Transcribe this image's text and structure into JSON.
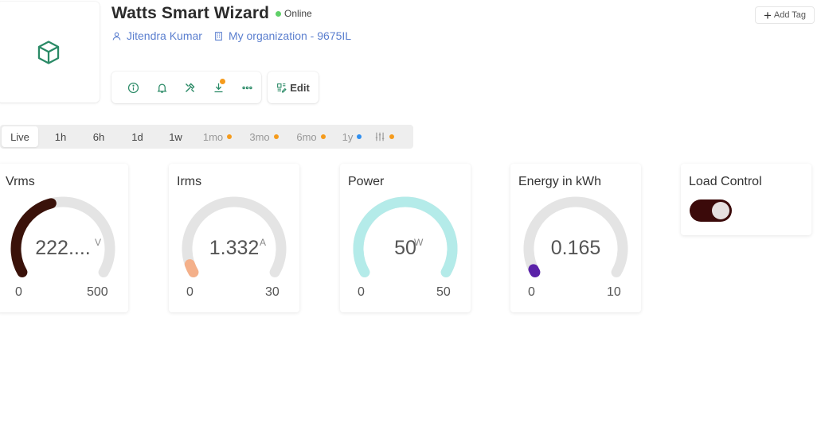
{
  "device": {
    "title": "Watts Smart Wizard",
    "status": "Online",
    "status_color": "#5fd068",
    "owner": "Jitendra Kumar",
    "organization": "My organization - 9675IL",
    "thumbnail_icon": "cube-icon"
  },
  "header": {
    "add_tag_label": "Add Tag",
    "edit_label": "Edit",
    "actions": [
      "info-icon",
      "bell-icon",
      "tools-icon",
      "download-icon",
      "more-icon"
    ]
  },
  "timebar": {
    "items": [
      {
        "label": "Live"
      },
      {
        "label": "1h"
      },
      {
        "label": "6h"
      },
      {
        "label": "1d"
      },
      {
        "label": "1w"
      },
      {
        "label": "1mo",
        "dot": "#f59b1c"
      },
      {
        "label": "3mo",
        "dot": "#f59b1c"
      },
      {
        "label": "6mo",
        "dot": "#f59b1c"
      },
      {
        "label": "1y",
        "dot": "#2f8ff0"
      }
    ],
    "settings_icon": "sliders-icon"
  },
  "widgets": [
    {
      "title": "Vrms",
      "value": "222....",
      "unit": "V",
      "min": "0",
      "max": "500",
      "fraction": 0.44,
      "color": "#3a120a"
    },
    {
      "title": "Irms",
      "value": "1.332",
      "unit": "A",
      "min": "0",
      "max": "30",
      "fraction": 0.044,
      "color": "#f4b08a"
    },
    {
      "title": "Power",
      "value": "50",
      "unit": "W",
      "min": "0",
      "max": "50",
      "fraction": 1.0,
      "color": "#b4ebe9"
    },
    {
      "title": "Energy in kWh",
      "value": "0.165",
      "unit": "",
      "min": "0",
      "max": "10",
      "fraction": 0.0165,
      "color": "#5a22a8"
    }
  ],
  "load_control": {
    "title": "Load Control",
    "state": "on"
  },
  "colors": {
    "accent_green": "#2a8a66",
    "link_blue": "#5b7fcf",
    "gauge_track": "#e4e4e4"
  }
}
